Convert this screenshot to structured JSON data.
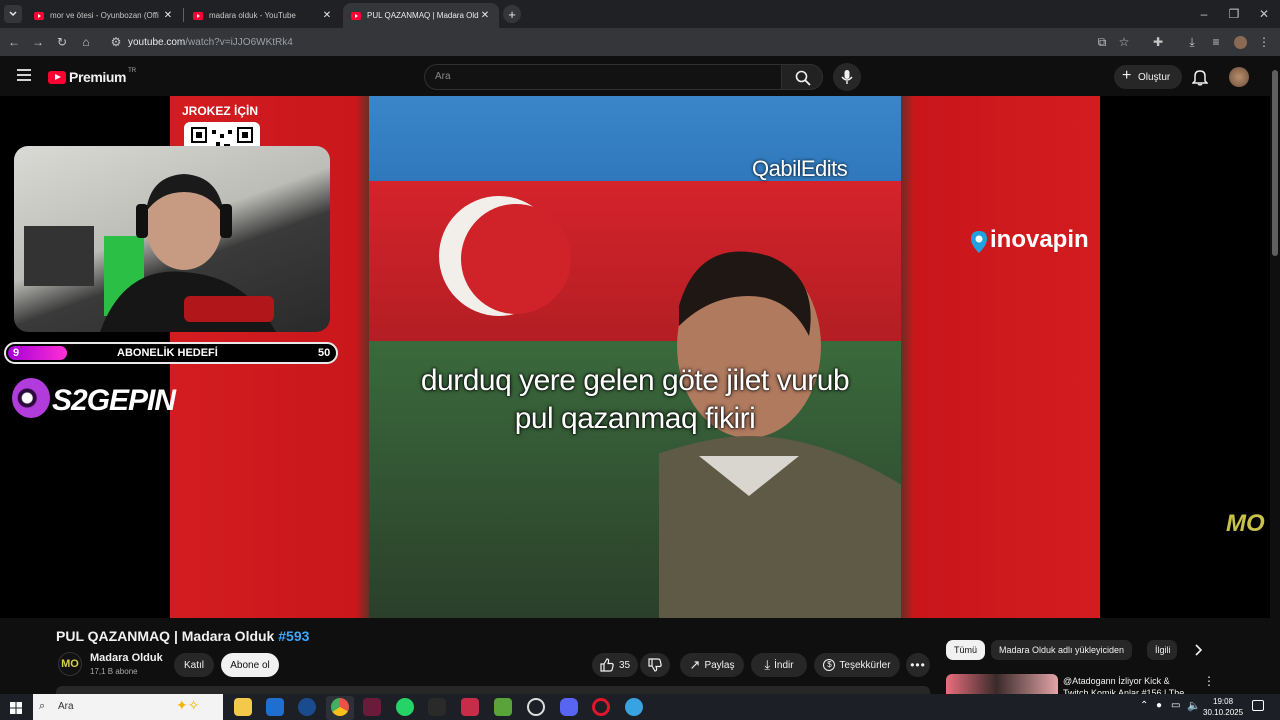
{
  "browser": {
    "tabs": [
      {
        "title": "mor ve ötesi - Oyunbozan (Offi",
        "active": false
      },
      {
        "title": "madara olduk - YouTube",
        "active": false
      },
      {
        "title": "PUL QAZANMAQ | Madara Olduk",
        "active": true
      }
    ],
    "url_host": "youtube.com",
    "url_path": "/watch?v=iJJO6WKtRk4"
  },
  "youtube": {
    "logo_text": "Premium",
    "region": "TR",
    "search_placeholder": "Ara",
    "create_label": "Oluştur"
  },
  "video_overlay": {
    "jrokez_label": "JROKEZ İÇİN",
    "watermark": "QabilEdits",
    "sponsor_right": "inovapin",
    "goal_current": "9",
    "goal_label": "ABONELİK HEDEFİ",
    "goal_target": "50",
    "goal_progress": 0.18,
    "sponsor_left": "S2GEPIN",
    "subtitle_line1": "durduq yere gelen göte jilet vurub",
    "subtitle_line2": "pul qazanmaq fikiri",
    "channel_mark": "MO"
  },
  "video": {
    "title_main": "PUL QAZANMAQ | Madara Olduk ",
    "title_tag": "#593",
    "channel_name": "Madara Olduk",
    "channel_avatar": "MO",
    "subscribers": "17,1 B abone",
    "join_label": "Katıl",
    "subscribe_label": "Abone ol",
    "like_count": "35",
    "share_label": "Paylaş",
    "download_label": "İndir",
    "thanks_label": "Teşekkürler"
  },
  "sidebar": {
    "chips": [
      "Tümü",
      "Madara Olduk adlı yükleyiciden",
      "İlgili"
    ],
    "reco_title": "@Atadogann İzliyor Kick & Twitch Komik Anlar #156 | The"
  },
  "taskbar": {
    "search_text": "Ara",
    "time": "19:08",
    "date": "30.10.2025"
  },
  "colors": {
    "youtube_red": "#ff0033",
    "accent_blue": "#3ea6ff",
    "goal_fill": "#ff2fd6"
  }
}
